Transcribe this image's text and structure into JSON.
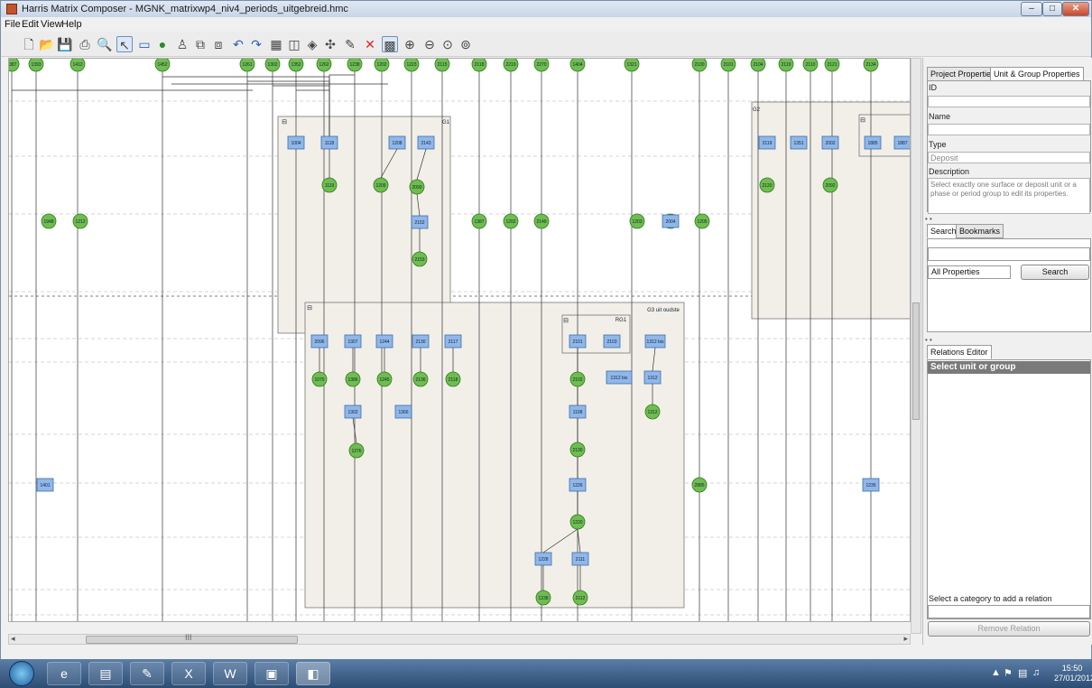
{
  "window": {
    "title": "Harris Matrix Composer - MGNK_matrixwp4_niv4_periods_uitgebreid.hmc",
    "min": "–",
    "max": "□",
    "close": "✕"
  },
  "menu": [
    "File",
    "Edit",
    "View",
    "Help"
  ],
  "toolbar": {
    "icons": [
      "new-file-icon",
      "open-folder-icon",
      "save-icon",
      "print-icon",
      "print-preview-icon",
      "select-arrow-icon",
      "rectangle-unit-icon",
      "circle-unit-icon",
      "person-icon",
      "group-icon",
      "period-group-icon",
      "relation-above-icon",
      "relation-below-icon",
      "table-icon",
      "chart-icon",
      "layers-icon",
      "plugin-icon",
      "properties-icon",
      "delete-icon",
      "grid-icon",
      "zoom-in-icon",
      "zoom-out-icon",
      "zoom-fit-icon",
      "zoom-reset-icon"
    ]
  },
  "matrix": {
    "top_nodes": [
      "1387",
      "1393",
      "1412",
      "1452",
      "1261",
      "1302",
      "1352",
      "1262",
      "1238",
      "1202",
      "1223",
      "2115",
      "2118",
      "2219",
      "2270",
      "1404",
      "1321",
      "2100",
      "2101",
      "2104",
      "2119",
      "2110",
      "2121",
      "2134"
    ],
    "group1": {
      "header_left": "⊟",
      "header_right": "G1",
      "rects": [
        "1004",
        "1118",
        "1208",
        "2143"
      ],
      "circles": [
        "1119",
        "1209",
        "2090"
      ],
      "rect2": "2152",
      "circle2": "2153"
    },
    "group2": {
      "header_left": "⊟",
      "label": "G2",
      "rects": [
        "2119",
        "1351",
        "2002",
        "1885",
        "1887"
      ],
      "circles": [
        "2120",
        "2092"
      ]
    },
    "mid_circles_left": [
      "1948",
      "1212"
    ],
    "mid_circles_right": [
      "1387",
      "1202",
      "2149",
      "1203",
      "2194",
      "1205"
    ],
    "rect_2004": "2004",
    "group3": {
      "header_left": "⊟",
      "header_right": "G3 uit oudste",
      "sub_header": "⊟",
      "sub_label": "RG1",
      "rects": [
        "2096",
        "1307",
        "1244",
        "2130",
        "2117"
      ],
      "circles": [
        "1075",
        "1386",
        "1245",
        "2136",
        "2118"
      ],
      "rects2": [
        "1302",
        "1366"
      ],
      "circle3": "1276",
      "rects_right": [
        "2101",
        "2103",
        "1312 bis"
      ],
      "circles_right": [
        "2102",
        "1312"
      ],
      "rect_wide": "1312 bis",
      "rect_1312": "1312",
      "rect_1108": "1108",
      "circle_2130": "2130",
      "circle_2131": "2131",
      "rect_1220": "1226",
      "circle_1220": "1220",
      "rect_1228": "1228",
      "rect_2111": "2111",
      "circle_1238": "1238",
      "circle_2112": "2112"
    },
    "low_rects": [
      "1401",
      "1235"
    ],
    "low_circle": "2885"
  },
  "side": {
    "top_tabs": [
      "Project Properties",
      "Unit & Group Properties"
    ],
    "fields": {
      "id_label": "ID",
      "name_label": "Name",
      "type_label": "Type",
      "type_value": "Deposit",
      "description_label": "Description",
      "description_text": "Select exactly one surface or deposit unit or a phase or period group to edit its properties."
    },
    "search_tabs": [
      "Search",
      "Bookmarks"
    ],
    "all_properties": "All Properties",
    "search_button": "Search",
    "rel_tab": "Relations Editor",
    "rel_header": "Select unit or group",
    "category_label": "Select a category to add a relation",
    "remove_button": "Remove Relation"
  },
  "scroll": {
    "label": "III"
  },
  "taskbar": {
    "time": "15:50",
    "date": "27/01/2012",
    "tray_icons": [
      "up-arrow-icon",
      "flag-icon",
      "network-icon",
      "volume-icon"
    ],
    "apps": [
      "ie-icon",
      "explorer-icon",
      "paint-icon",
      "excel-icon",
      "word-icon",
      "folder-icon",
      "harris-app-icon"
    ]
  }
}
